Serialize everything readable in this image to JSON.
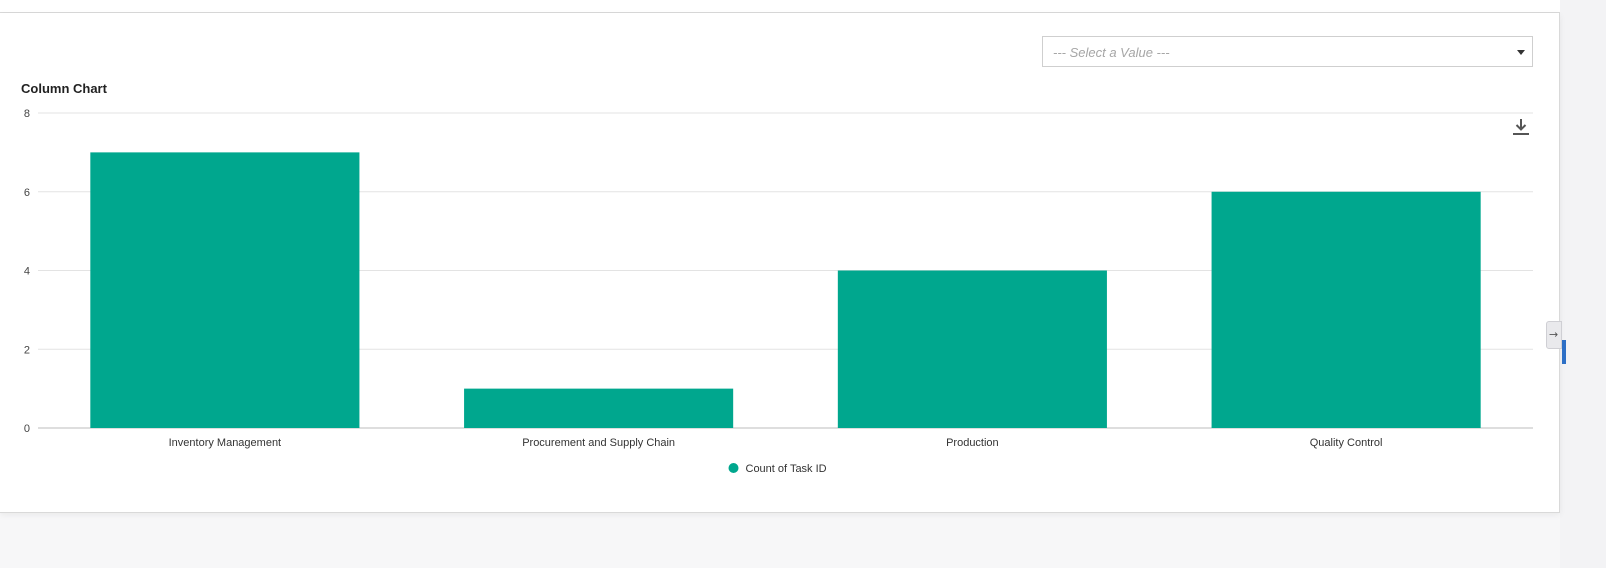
{
  "select": {
    "placeholder": "--- Select a Value ---"
  },
  "chart_data": {
    "type": "bar",
    "title": "Column Chart",
    "categories": [
      "Inventory Management",
      "Procurement and Supply Chain",
      "Production",
      "Quality Control"
    ],
    "series": [
      {
        "name": "Count of Task ID",
        "values": [
          7,
          1,
          4,
          6
        ],
        "color": "#00a78e"
      }
    ],
    "ylim": [
      0,
      8
    ],
    "yticks": [
      0,
      2,
      4,
      6,
      8
    ],
    "grid": true,
    "legend_position": "bottom-center",
    "xlabel": "",
    "ylabel": ""
  },
  "icons": {
    "download": "download-icon",
    "dropdown": "chevron-down-icon",
    "collapse": "arrow-right-icon"
  }
}
